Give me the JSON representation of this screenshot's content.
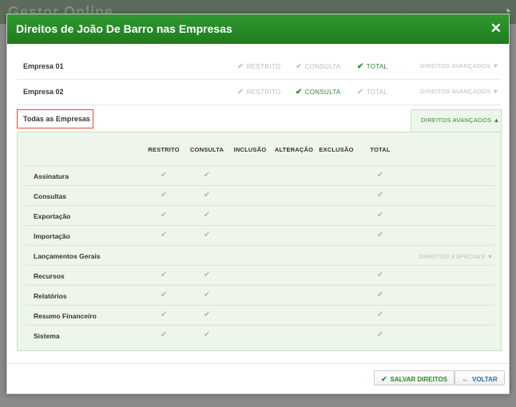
{
  "background": {
    "brand": "Gestor Online"
  },
  "modal": {
    "title": "Direitos de João De Barro nas Empresas",
    "close_glyph": "✕"
  },
  "companies": [
    {
      "name": "Empresa 01",
      "restrito": "RESTRITO",
      "consulta": "CONSULTA",
      "total": "TOTAL",
      "selected": "total",
      "advanced": "DIREITOS AVANÇADOS ▼"
    },
    {
      "name": "Empresa 02",
      "restrito": "RESTRITO",
      "consulta": "CONSULTA",
      "total": "TOTAL",
      "selected": "consulta",
      "advanced": "DIREITOS AVANÇADOS ▼"
    }
  ],
  "all_companies": {
    "label": "Todas as Empresas",
    "advanced_tab": "DIREITOS AVANÇADOS ▲"
  },
  "columns": [
    "RESTRITO",
    "CONSULTA",
    "INCLUSÃO",
    "ALTERAÇÃO",
    "EXCLUSÃO",
    "TOTAL"
  ],
  "permissions": [
    {
      "label": "Assinatura",
      "restrito": true,
      "consulta": true,
      "total": true
    },
    {
      "label": "Consultas",
      "restrito": true,
      "consulta": true,
      "total": true
    },
    {
      "label": "Exportação",
      "restrito": true,
      "consulta": true,
      "total": true
    },
    {
      "label": "Importação",
      "restrito": true,
      "consulta": true,
      "total": true
    },
    {
      "label": "Lançamentos Gerais",
      "special": "DIREITOS ESPECIAIS ▼"
    },
    {
      "label": "Recursos",
      "restrito": true,
      "consulta": true,
      "total": true
    },
    {
      "label": "Relatórios",
      "restrito": true,
      "consulta": true,
      "total": true
    },
    {
      "label": "Resumo Financeiro",
      "restrito": true,
      "consulta": true,
      "total": true
    },
    {
      "label": "Sistema",
      "restrito": true,
      "consulta": true,
      "total": true
    }
  ],
  "footer": {
    "save": "SALVAR DIREITOS",
    "back": "VOLTAR"
  },
  "colors": {
    "accent": "#2d8a2d",
    "header": "#1f7a1f",
    "highlight_border": "#e0502e"
  }
}
